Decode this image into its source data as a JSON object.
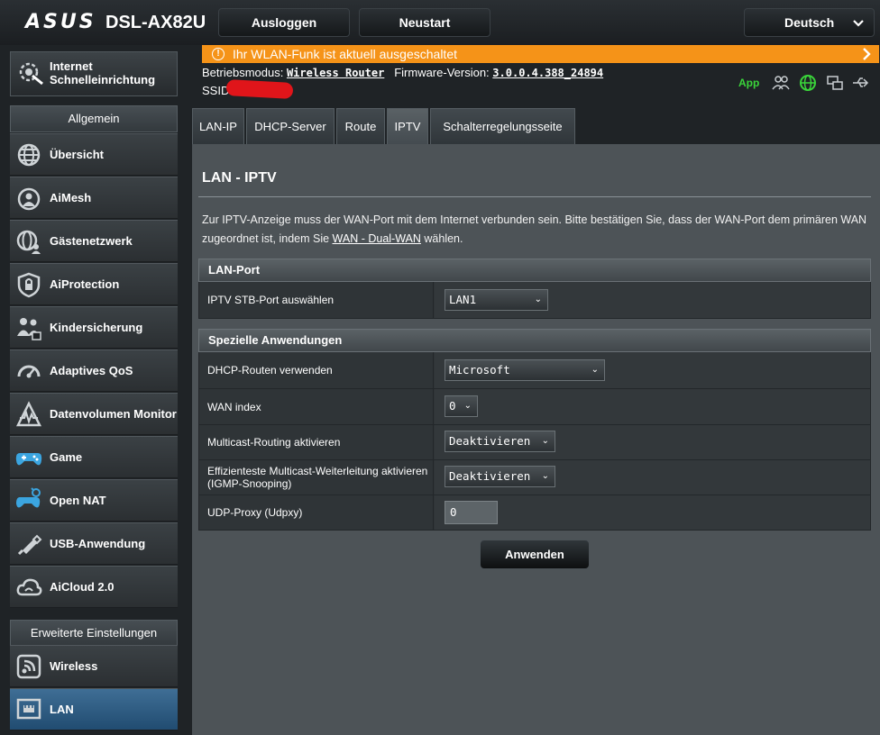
{
  "header": {
    "logo": "ASUS",
    "model": "DSL-AX82U",
    "logout": "Ausloggen",
    "restart": "Neustart",
    "language": "Deutsch"
  },
  "sidebar": {
    "quick_setup": "Internet Schnelleinrichtung",
    "general_title": "Allgemein",
    "general_items": [
      {
        "label": "Übersicht",
        "icon": "globe-icon"
      },
      {
        "label": "AiMesh",
        "icon": "aimesh-icon"
      },
      {
        "label": "Gästenetzwerk",
        "icon": "guest-network-icon"
      },
      {
        "label": "AiProtection",
        "icon": "shield-lock-icon"
      },
      {
        "label": "Kindersicherung",
        "icon": "family-icon"
      },
      {
        "label": "Adaptives QoS",
        "icon": "gauge-icon"
      },
      {
        "label": "Datenvolumen Monitor",
        "icon": "traffic-monitor-icon"
      },
      {
        "label": "Game",
        "icon": "gamepad-icon"
      },
      {
        "label": "Open NAT",
        "icon": "open-nat-icon"
      },
      {
        "label": "USB-Anwendung",
        "icon": "usb-icon"
      },
      {
        "label": "AiCloud 2.0",
        "icon": "cloud-icon"
      }
    ],
    "advanced_title": "Erweiterte Einstellungen",
    "advanced_items": [
      {
        "label": "Wireless",
        "icon": "wireless-icon"
      },
      {
        "label": "LAN",
        "icon": "lan-icon",
        "active": true
      }
    ]
  },
  "status": {
    "banner": "Ihr WLAN-Funk ist aktuell ausgeschaltet",
    "mode_label": "Betriebsmodus:",
    "mode_value": "Wireless Router",
    "firmware_label": "Firmware-Version:",
    "firmware_value": "3.0.0.4.388_24894",
    "ssid_label": "SSID",
    "app_label": "App"
  },
  "tabs": [
    {
      "label": "LAN-IP"
    },
    {
      "label": "DHCP-Server"
    },
    {
      "label": "Route"
    },
    {
      "label": "IPTV",
      "active": true
    },
    {
      "label": "Schalterregelungsseite"
    }
  ],
  "page": {
    "title": "LAN - IPTV",
    "description_pre": "Zur IPTV-Anzeige muss der WAN-Port mit dem Internet verbunden sein. Bitte bestätigen Sie, dass der WAN-Port dem primären WAN zugeordnet ist, indem Sie ",
    "description_link": "WAN - Dual-WAN",
    "description_post": " wählen.",
    "lan_port": {
      "header": "LAN-Port",
      "stb_label": "IPTV STB-Port auswählen",
      "stb_value": "LAN1"
    },
    "special": {
      "header": "Spezielle Anwendungen",
      "dhcp_routes_label": "DHCP-Routen verwenden",
      "dhcp_routes_value": "Microsoft",
      "wan_index_label": "WAN index",
      "wan_index_value": "0",
      "multicast_label": "Multicast-Routing aktivieren",
      "multicast_value": "Deaktivieren",
      "igmp_label": "Effizienteste Multicast-Weiterleitung aktivieren (IGMP-Snooping)",
      "igmp_value": "Deaktivieren",
      "udpxy_label": "UDP-Proxy (Udpxy)",
      "udpxy_value": "0"
    },
    "apply": "Anwenden"
  }
}
